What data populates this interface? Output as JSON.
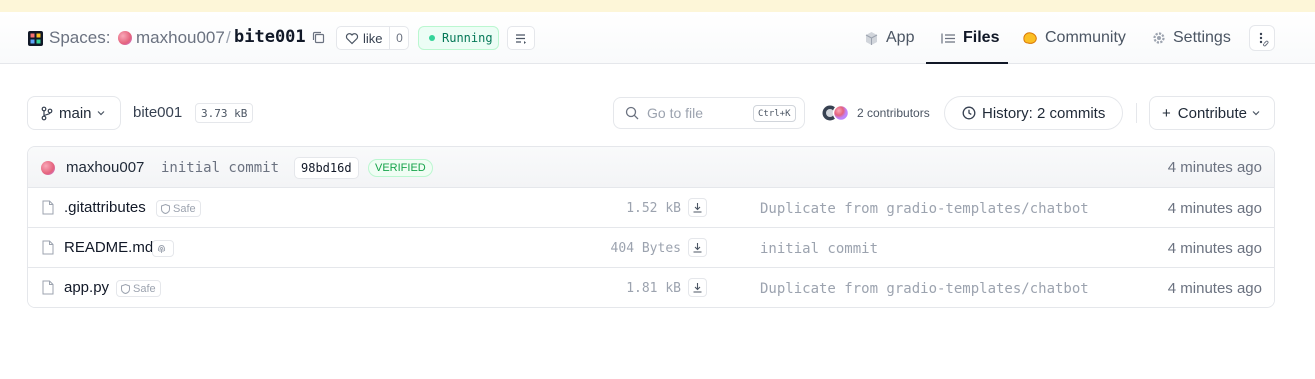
{
  "header": {
    "section_label": "Spaces:",
    "owner": "maxhou007",
    "separator": "/",
    "repo": "bite001",
    "like_label": "like",
    "like_count": "0",
    "status": "Running",
    "nav": [
      {
        "label": "App",
        "icon": "cube-icon"
      },
      {
        "label": "Files",
        "icon": "files-icon",
        "active": true
      },
      {
        "label": "Community",
        "icon": "community-icon"
      },
      {
        "label": "Settings",
        "icon": "gear-icon"
      }
    ]
  },
  "toolbar": {
    "branch": "main",
    "repo_name": "bite001",
    "repo_size": "3.73 kB",
    "goto_placeholder": "Go to file",
    "goto_shortcut": "Ctrl+K",
    "contributors": "2 contributors",
    "history": "History: 2 commits",
    "contribute": "Contribute"
  },
  "last_commit": {
    "author": "maxhou007",
    "message": "initial commit",
    "hash": "98bd16d",
    "badge": "VERIFIED",
    "time": "4 minutes ago"
  },
  "files": [
    {
      "name": ".gitattributes",
      "badge": "Safe",
      "size": "1.52 kB",
      "commit": "Duplicate from gradio-templates/chatbot",
      "time": "4 minutes ago"
    },
    {
      "name": "README.md",
      "badge": "",
      "size": "404 Bytes",
      "commit": "initial commit",
      "time": "4 minutes ago"
    },
    {
      "name": "app.py",
      "badge": "Safe",
      "size": "1.81 kB",
      "commit": "Duplicate from gradio-templates/chatbot",
      "time": "4 minutes ago"
    }
  ],
  "colors": {
    "accent_dark": "#111827",
    "running_green": "#047857",
    "verified_green": "#16a34a",
    "banner": "#fdf6d8"
  }
}
